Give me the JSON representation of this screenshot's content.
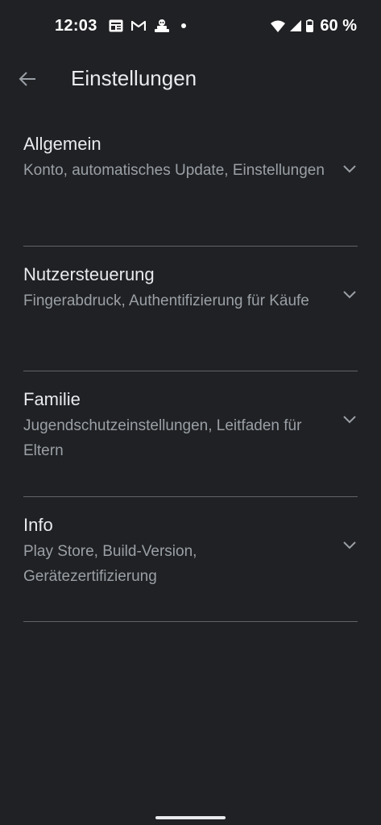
{
  "status_bar": {
    "time": "12:03",
    "notification_icons": [
      "news-icon",
      "gmail-icon",
      "game-icon"
    ],
    "battery_percent": "60 %"
  },
  "app_bar": {
    "title": "Einstellungen"
  },
  "sections": [
    {
      "title": "Allgemein",
      "subtitle": "Konto, automatisches Update, Einstellungen"
    },
    {
      "title": "Nutzersteuerung",
      "subtitle": "Fingerabdruck, Authentifizierung für Käufe"
    },
    {
      "title": "Familie",
      "subtitle": "Jugendschutzeinstellungen, Leitfaden für Eltern"
    },
    {
      "title": "Info",
      "subtitle": "Play Store, Build-Version, Gerätezertifizierung"
    }
  ],
  "colors": {
    "background": "#202124",
    "primary_text": "#e8eaed",
    "secondary_text": "#9aa0a6",
    "divider": "#5f6368"
  }
}
